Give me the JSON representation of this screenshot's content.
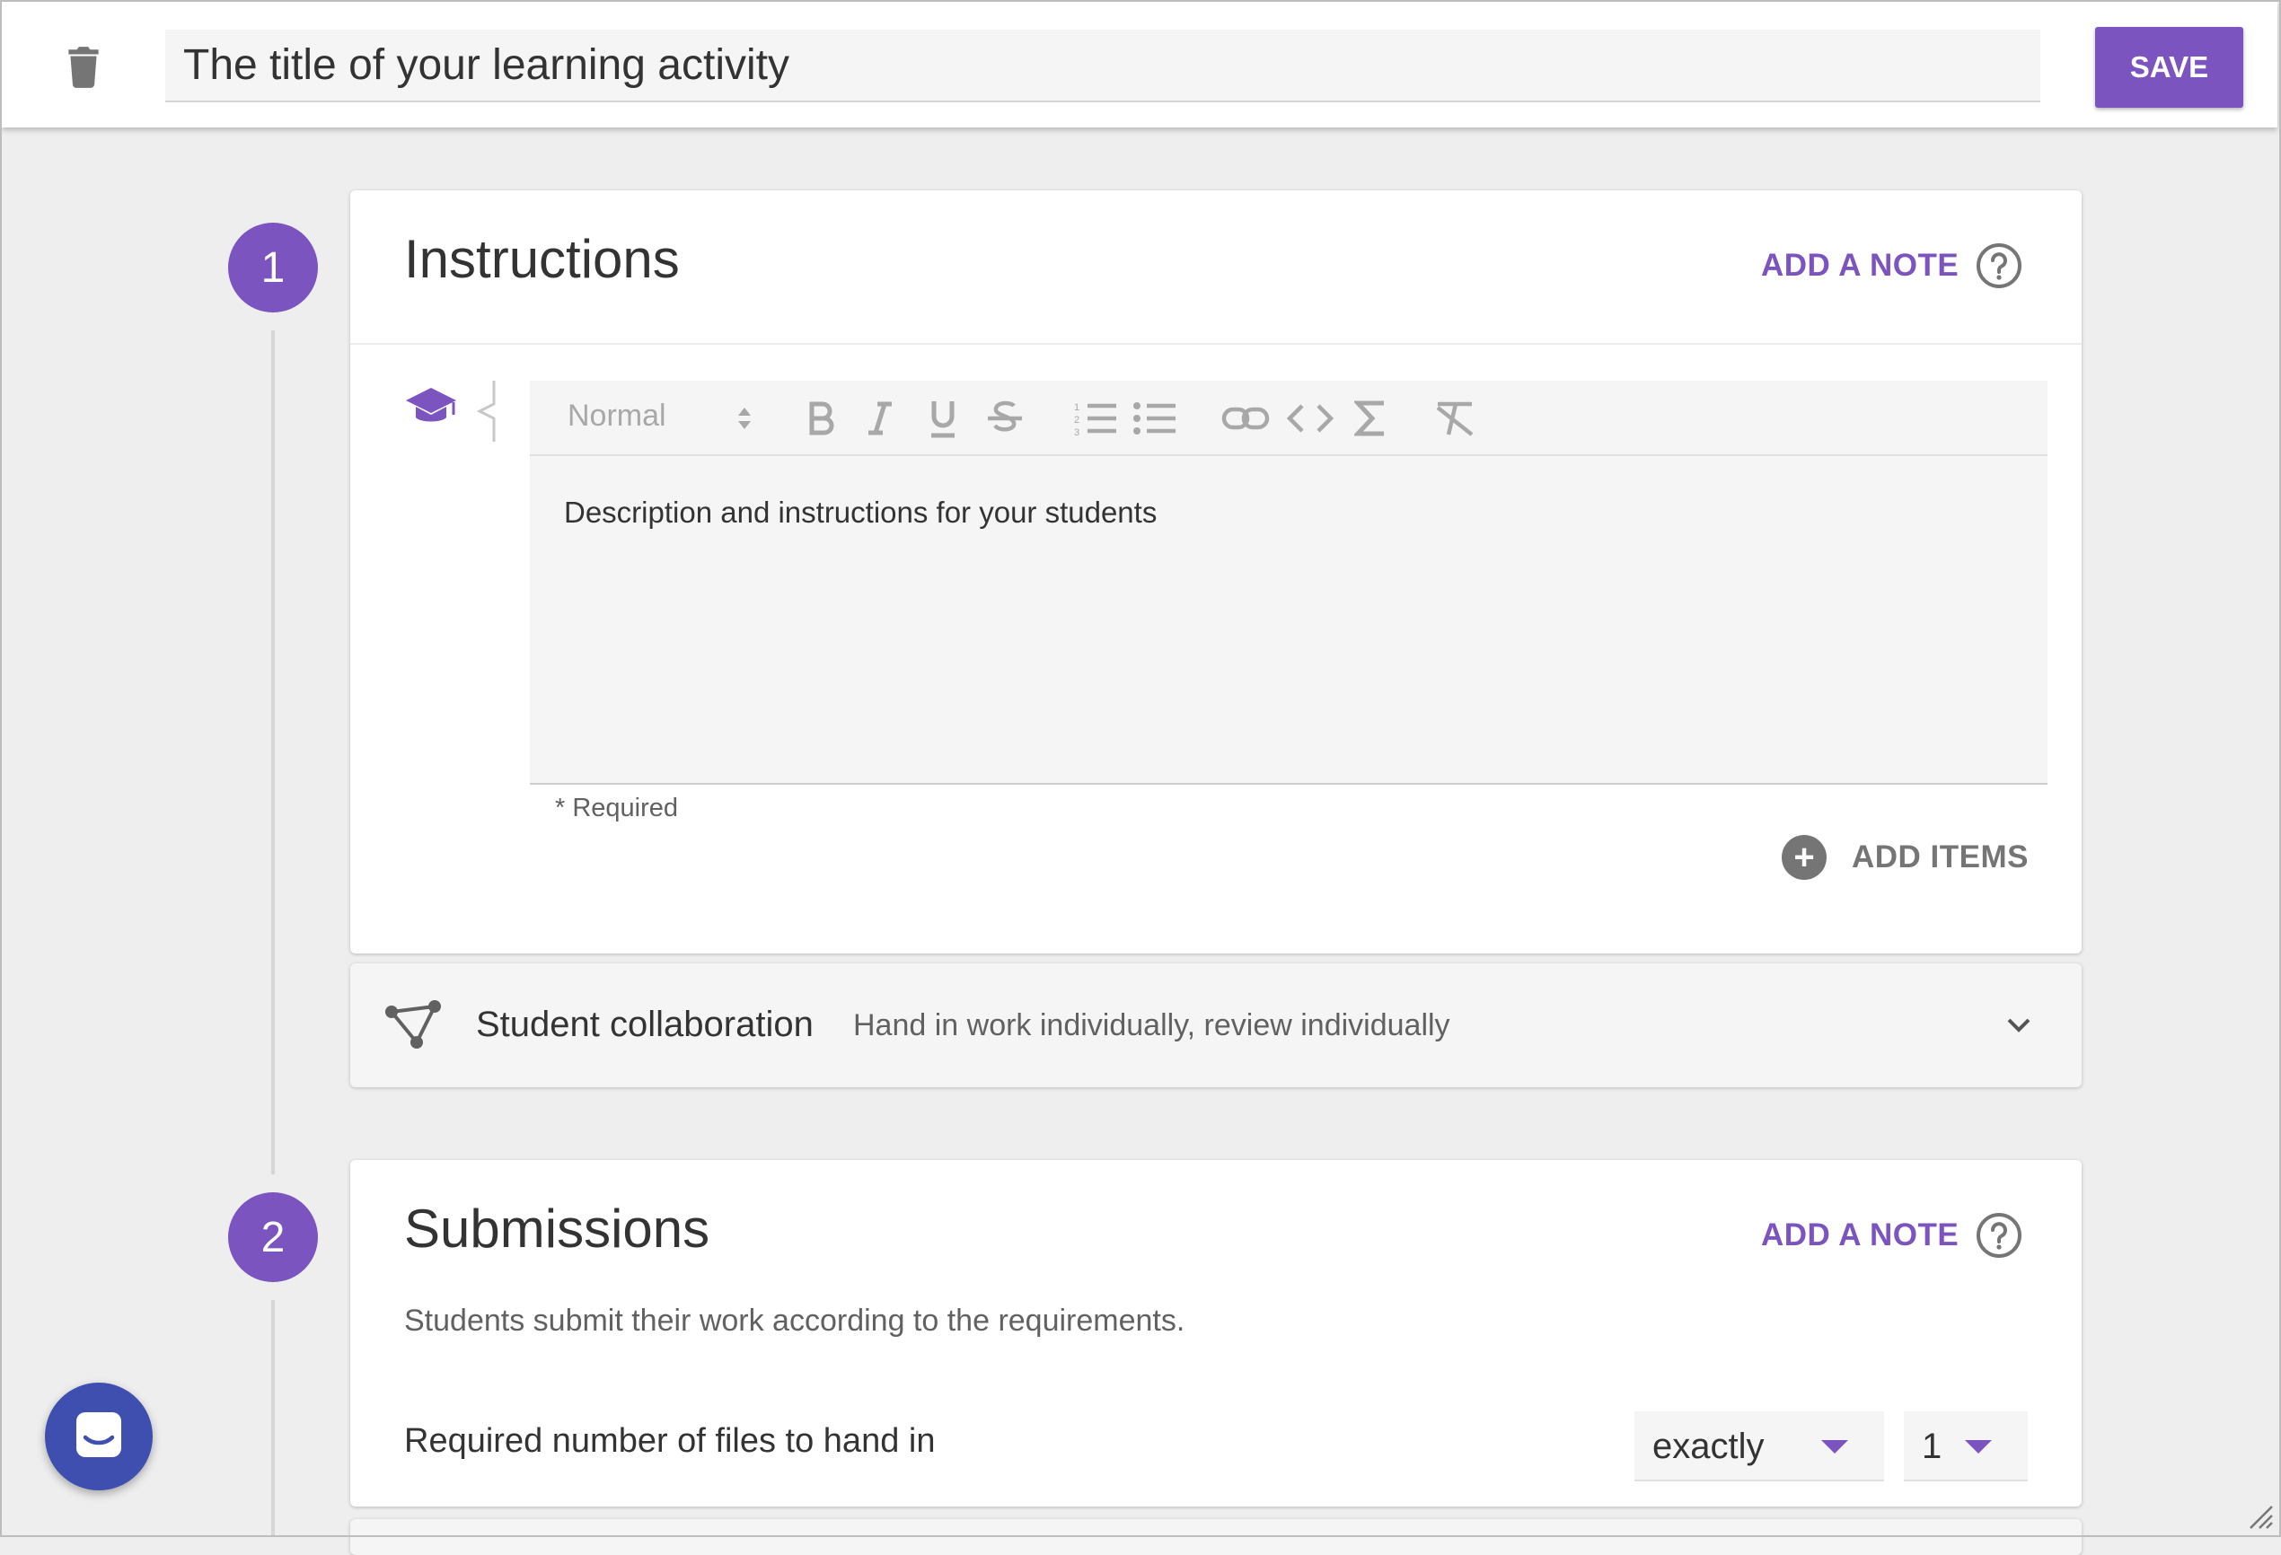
{
  "header": {
    "title_value": "The title of your learning activity",
    "save_label": "SAVE"
  },
  "instructions": {
    "step_number": "1",
    "title": "Instructions",
    "add_note_label": "ADD A NOTE",
    "editor": {
      "format_select": "Normal",
      "body_text": "Description and instructions for your students"
    },
    "required_text": "* Required",
    "add_items_label": "ADD ITEMS"
  },
  "collaboration": {
    "title": "Student collaboration",
    "description": "Hand in work individually, review individually"
  },
  "submissions": {
    "step_number": "2",
    "title": "Submissions",
    "add_note_label": "ADD A NOTE",
    "description": "Students submit their work according to the requirements.",
    "files_label": "Required number of files to hand in",
    "quantifier_value": "exactly",
    "count_value": "1"
  },
  "colors": {
    "accent": "#7c54bf",
    "chat_button": "#3f4fb0"
  },
  "icons": {
    "trash": "trash-icon",
    "help": "help-circle-icon",
    "student": "graduation-cap-icon",
    "collaboration": "network-icon",
    "chat": "chat-icon"
  }
}
